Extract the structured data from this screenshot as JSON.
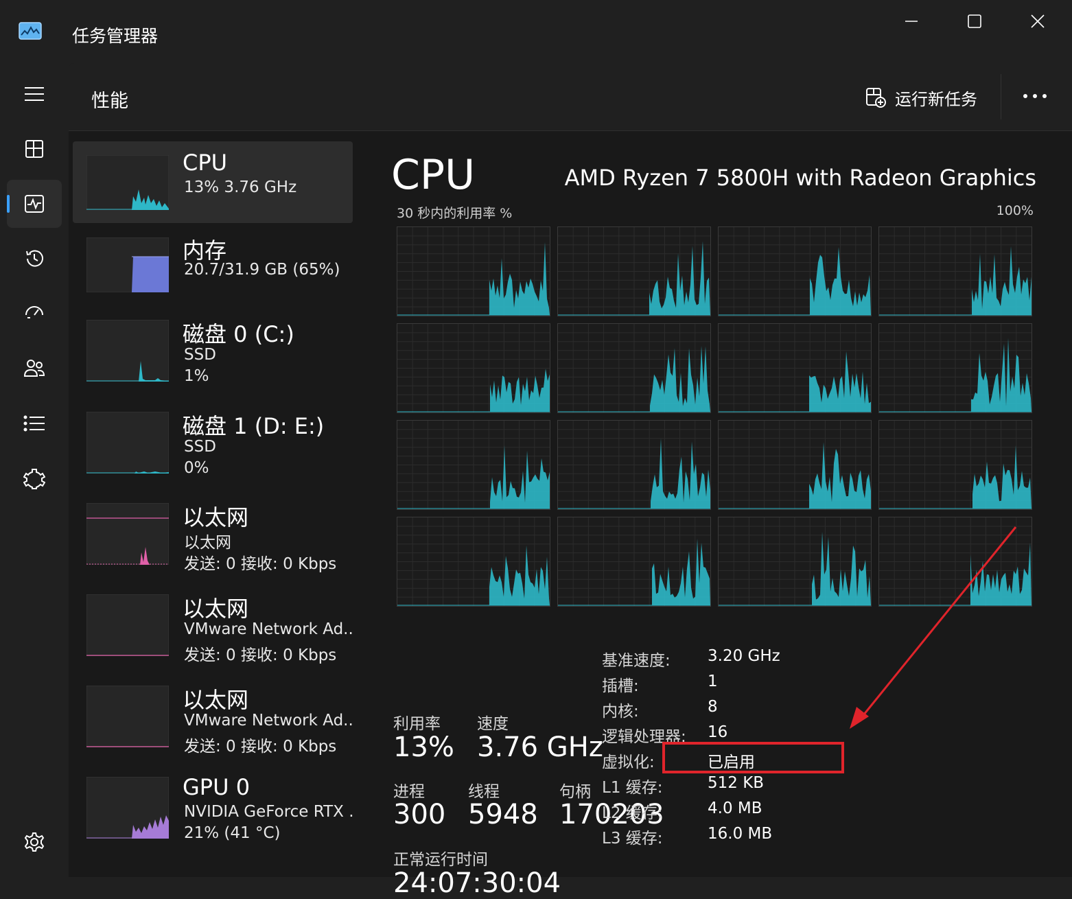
{
  "app": {
    "title": "任务管理器",
    "icon": "task-manager-icon"
  },
  "window_controls": {
    "minimize": "minimize-icon",
    "maximize": "maximize-icon",
    "close": "close-icon"
  },
  "nav": {
    "items": [
      "hamburger-menu-icon",
      "processes-icon",
      "performance-icon",
      "app-history-icon",
      "startup-apps-icon",
      "users-icon",
      "details-icon",
      "services-icon",
      "settings-icon"
    ],
    "active": "performance-icon"
  },
  "header": {
    "title": "性能",
    "run_new_task": "运行新任务",
    "more": "more-options-icon"
  },
  "resources": [
    {
      "name": "CPU",
      "lines": [
        "13%  3.76 GHz"
      ]
    },
    {
      "name": "内存",
      "lines": [
        "20.7/31.9 GB (65%)"
      ]
    },
    {
      "name": "磁盘 0 (C:)",
      "lines": [
        "SSD",
        "1%"
      ]
    },
    {
      "name": "磁盘 1 (D: E:)",
      "lines": [
        "SSD",
        "0%"
      ]
    },
    {
      "name": "以太网",
      "lines": [
        "以太网",
        "发送: 0 接收: 0 Kbps"
      ]
    },
    {
      "name": "以太网",
      "lines": [
        "VMware Network Ad..",
        "发送: 0 接收: 0 Kbps"
      ]
    },
    {
      "name": "以太网",
      "lines": [
        "VMware Network Ad..",
        "发送: 0 接收: 0 Kbps"
      ]
    },
    {
      "name": "GPU 0",
      "lines": [
        "NVIDIA GeForce RTX .",
        "21% (41 °C)"
      ]
    }
  ],
  "colors": {
    "cpu": "#2eb8c8",
    "memory": "#6b78d6",
    "network": "#e060a8",
    "gpu": "#a67bd6",
    "highlight": "#e0242b",
    "accent": "#3aa0ff"
  },
  "cpu": {
    "title": "CPU",
    "model": "AMD Ryzen 7 5800H with Radeon Graphics",
    "graph_label": "30 秒内的利用率 %",
    "graph_max": "100%",
    "stats": {
      "util_label": "利用率",
      "util_value": "13%",
      "speed_label": "速度",
      "speed_value": "3.76 GHz",
      "proc_label": "进程",
      "proc_value": "300",
      "thread_label": "线程",
      "thread_value": "5948",
      "handle_label": "句柄",
      "handle_value": "170203",
      "uptime_label": "正常运行时间",
      "uptime_value": "24:07:30:04"
    },
    "info": [
      {
        "k": "基准速度:",
        "v": "3.20 GHz"
      },
      {
        "k": "插槽:",
        "v": "1"
      },
      {
        "k": "内核:",
        "v": "8"
      },
      {
        "k": "逻辑处理器:",
        "v": "16"
      },
      {
        "k": "虚拟化:",
        "v": "已启用"
      },
      {
        "k": "L1 缓存:",
        "v": "512 KB"
      },
      {
        "k": "L2 缓存:",
        "v": "4.0 MB"
      },
      {
        "k": "L3 缓存:",
        "v": "16.0 MB"
      }
    ]
  }
}
